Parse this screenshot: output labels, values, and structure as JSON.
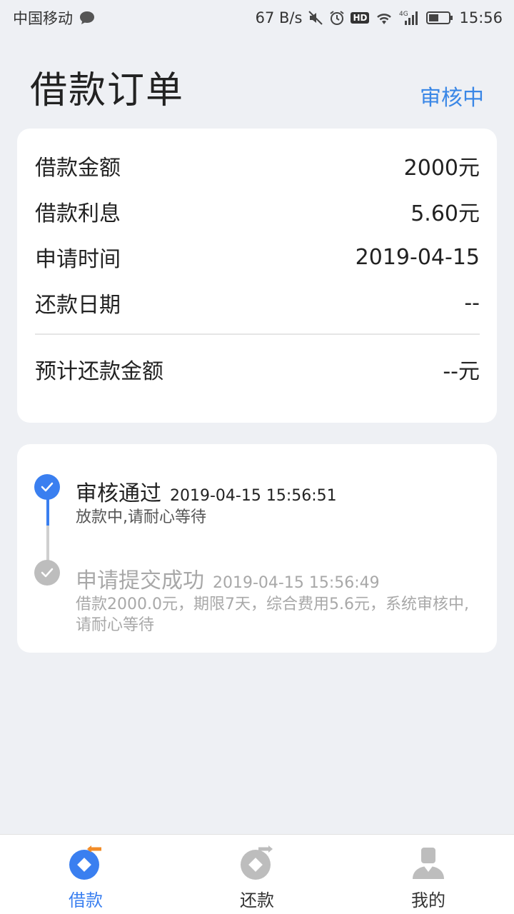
{
  "status_bar": {
    "carrier": "中国移动",
    "speed": "67 B/s",
    "time": "15:56",
    "hd": "HD",
    "network": "4G"
  },
  "header": {
    "title": "借款订单",
    "status": "审核中"
  },
  "details": {
    "rows": [
      {
        "label": "借款金额",
        "value": "2000元"
      },
      {
        "label": "借款利息",
        "value": "5.60元"
      },
      {
        "label": "申请时间",
        "value": "2019-04-15"
      },
      {
        "label": "还款日期",
        "value": "--"
      }
    ],
    "estimate": {
      "label": "预计还款金额",
      "value": "--元"
    }
  },
  "timeline": [
    {
      "title": "审核通过",
      "time": "2019-04-15 15:56:51",
      "desc": "放款中,请耐心等待",
      "state": "active"
    },
    {
      "title": "申请提交成功",
      "time": "2019-04-15 15:56:49",
      "desc": "借款2000.0元，期限7天，综合费用5.6元，系统审核中,请耐心等待",
      "state": "done"
    }
  ],
  "nav": {
    "items": [
      {
        "label": "借款",
        "active": true
      },
      {
        "label": "还款",
        "active": false
      },
      {
        "label": "我的",
        "active": false
      }
    ]
  },
  "colors": {
    "accent": "#3a7ff0",
    "status_blue": "#3a87e6",
    "inactive_gray": "#bdbdbd",
    "nav_orange": "#f28c28"
  }
}
